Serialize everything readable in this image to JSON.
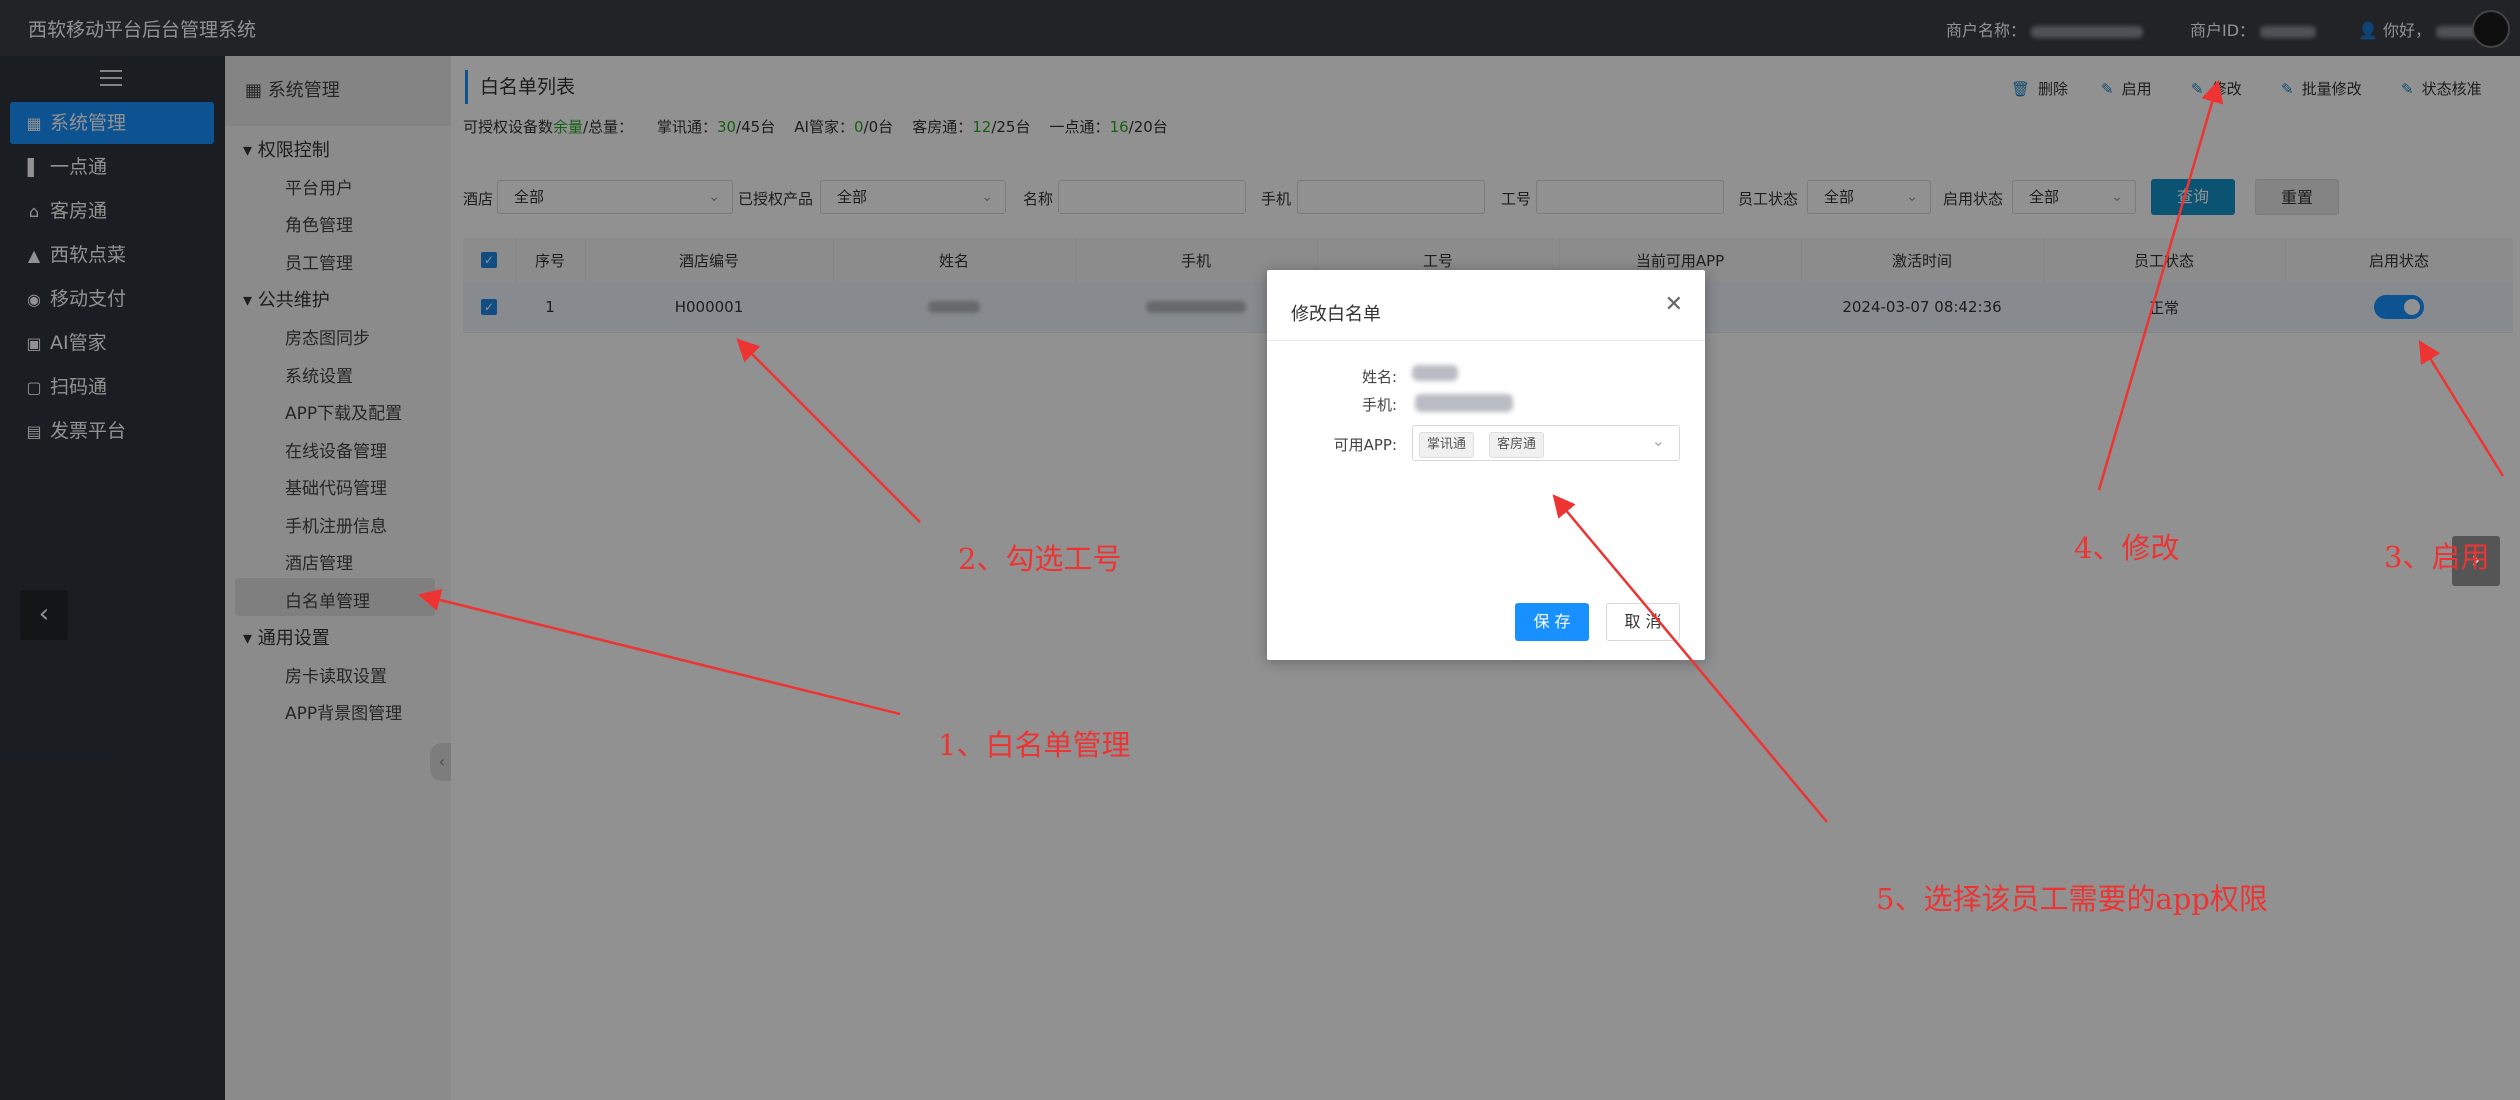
{
  "app_title": "西软移动平台后台管理系统",
  "header": {
    "merchant_name_label": "商户名称：",
    "merchant_id_label": "商户ID：",
    "greeting": "你好，"
  },
  "main_nav": {
    "items": [
      {
        "label": "系统管理",
        "icon": "grid-icon",
        "active": true
      },
      {
        "label": "一点通",
        "icon": "bar-chart-icon"
      },
      {
        "label": "客房通",
        "icon": "home-icon"
      },
      {
        "label": "西软点菜",
        "icon": "dish-icon"
      },
      {
        "label": "移动支付",
        "icon": "pay-icon"
      },
      {
        "label": "AI管家",
        "icon": "ai-icon"
      },
      {
        "label": "扫码通",
        "icon": "scan-icon"
      },
      {
        "label": "发票平台",
        "icon": "invoice-icon"
      }
    ]
  },
  "sub_nav": {
    "header": "系统管理",
    "groups": [
      {
        "label": "权限控制",
        "items": [
          "平台用户",
          "角色管理",
          "员工管理"
        ]
      },
      {
        "label": "公共维护",
        "items": [
          "房态图同步",
          "系统设置",
          "APP下载及配置",
          "在线设备管理",
          "基础代码管理",
          "手机注册信息",
          "酒店管理",
          "白名单管理"
        ]
      },
      {
        "label": "通用设置",
        "items": [
          "房卡读取设置",
          "APP背景图管理"
        ]
      }
    ],
    "active_item": "白名单管理"
  },
  "page": {
    "title": "白名单列表",
    "quota": {
      "prefix": "可授权设备数",
      "remain_word": "余量",
      "suffix": "/总量：",
      "items": [
        {
          "label": "掌讯通：",
          "used": "30",
          "total": "/45台"
        },
        {
          "label": "AI管家：",
          "used": "0",
          "total": "/0台"
        },
        {
          "label": "客房通：",
          "used": "12",
          "total": "/25台"
        },
        {
          "label": "一点通：",
          "used": "16",
          "total": "/20台"
        }
      ]
    },
    "toolbar": [
      "删除",
      "启用",
      "修改",
      "批量修改",
      "状态核准"
    ],
    "filters": {
      "hotel_label": "酒店",
      "hotel_value": "全部",
      "product_label": "已授权产品",
      "product_value": "全部",
      "name_label": "名称",
      "phone_label": "手机",
      "staff_no_label": "工号",
      "staff_status_label": "员工状态",
      "staff_status_value": "全部",
      "enable_status_label": "启用状态",
      "enable_status_value": "全部",
      "query": "查询",
      "reset": "重置"
    },
    "table": {
      "columns": [
        "序号",
        "酒店编号",
        "姓名",
        "手机",
        "工号",
        "当前可用APP",
        "激活时间",
        "员工状态",
        "启用状态"
      ],
      "rows": [
        {
          "index": "1",
          "hotel_no": "H000001",
          "activated_at": "2024-03-07 08:42:36",
          "staff_status": "正常",
          "enabled": true
        }
      ]
    }
  },
  "modal": {
    "title": "修改白名单",
    "name_label": "姓名:",
    "phone_label": "手机:",
    "app_label": "可用APP:",
    "apps": [
      "掌讯通",
      "客房通"
    ],
    "save": "保 存",
    "cancel": "取 消"
  },
  "annotations": [
    "1、白名单管理",
    "2、勾选工号",
    "3、启用",
    "4、修改",
    "5、选择该员工需要的app权限"
  ],
  "colors": {
    "accent": "#1890ff",
    "annotation": "#e33333",
    "topbar": "#3a3e45"
  }
}
